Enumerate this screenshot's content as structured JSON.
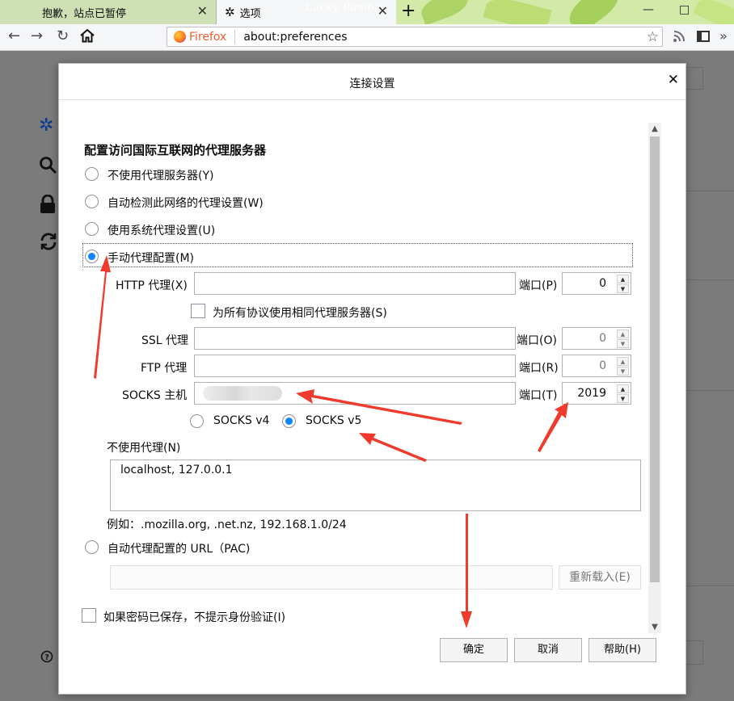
{
  "tabs": [
    {
      "title": "抱歉，站点已暂停",
      "close": "✕"
    },
    {
      "title": "选项",
      "close": "✕"
    }
  ],
  "theme_text": "Lucky Bambo",
  "window_controls": {
    "minimize": "—",
    "restore": "□"
  },
  "url_bar": {
    "identity_label": "Firefox",
    "url": "about:preferences"
  },
  "dialog": {
    "title": "连接设置",
    "close": "✕",
    "section_title": "配置访问国际互联网的代理服务器",
    "proxy_options": {
      "none": "不使用代理服务器(Y)",
      "auto_detect": "自动检测此网络的代理设置(W)",
      "system": "使用系统代理设置(U)",
      "manual": "手动代理配置(M)",
      "pac": "自动代理配置的 URL（PAC)"
    },
    "selected_option": "manual",
    "http": {
      "label": "HTTP 代理(X)",
      "port_label": "端口(P)",
      "port": "0"
    },
    "same_proxy": "为所有协议使用相同代理服务器(S)",
    "ssl": {
      "label": "SSL 代理",
      "port_label": "端口(O)",
      "port": "0"
    },
    "ftp": {
      "label": "FTP 代理",
      "port_label": "端口(R)",
      "port": "0"
    },
    "socks": {
      "label": "SOCKS 主机",
      "port_label": "端口(T)",
      "port": "2019",
      "v4": "SOCKS v4",
      "v5": "SOCKS v5",
      "version_selected": "v5"
    },
    "no_proxy": {
      "label": "不使用代理(N)",
      "value": "localhost, 127.0.0.1",
      "example": "例如：.mozilla.org, .net.nz, 192.168.1.0/24"
    },
    "reload_button": "重新载入(E)",
    "no_auth_prompt": "如果密码已保存，不提示身份验证(I)",
    "buttons": {
      "ok": "确定",
      "cancel": "取消",
      "help": "帮助(H)"
    }
  },
  "colors": {
    "accent": "#0a84ff",
    "annotation_arrow": "#f03a2e",
    "firefox_label": "#ef5c2a",
    "dim_overlay": "#7b7b7b"
  }
}
